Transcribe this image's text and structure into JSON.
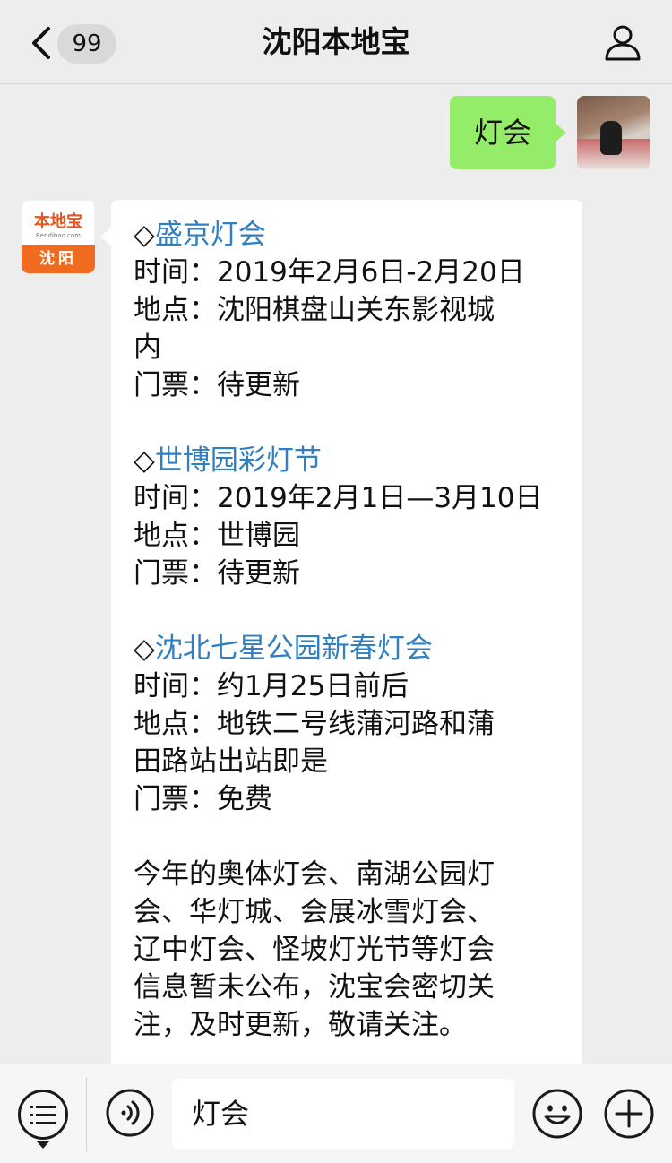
{
  "nav": {
    "unread_count": "99",
    "title": "沈阳本地宝"
  },
  "outgoing": {
    "text": "灯会"
  },
  "bot_avatar": {
    "logo_text": "本地宝",
    "logo_url_text": "Bendibao.com",
    "city": "沈阳"
  },
  "message": {
    "events": [
      {
        "marker": "◇",
        "name": "盛京灯会",
        "time": "时间：2019年2月6日-2月20日",
        "place_lines": [
          "地点：沈阳棋盘山关东影视城",
          "内"
        ],
        "ticket": "门票：待更新"
      },
      {
        "marker": "◇",
        "name": "世博园彩灯节",
        "time": "时间：2019年2月1日—3月10日",
        "place_lines": [
          "地点：世博园"
        ],
        "ticket": "门票：待更新"
      },
      {
        "marker": "◇",
        "name": "沈北七星公园新春灯会",
        "time": "时间：约1月25日前后",
        "place_lines": [
          "地点：地铁二号线蒲河路和蒲",
          "田路站出站即是"
        ],
        "ticket": "门票：免费"
      }
    ],
    "footer_lines": [
      "今年的奥体灯会、南湖公园灯",
      "会、华灯城、会展冰雪灯会、",
      "辽中灯会、怪坡灯光节等灯会",
      "信息暂未公布，沈宝会密切关",
      "注，及时更新，敬请关注。"
    ],
    "link_color": "#2f7fc1"
  },
  "input": {
    "value": "灯会"
  },
  "icons": {
    "back": "chevron-left-icon",
    "user": "user-icon",
    "menu": "list-menu-icon",
    "voice": "voice-icon",
    "emoji": "emoji-icon",
    "plus": "plus-icon"
  },
  "colors": {
    "bubble_out": "#95ec69",
    "background": "#ededed"
  }
}
